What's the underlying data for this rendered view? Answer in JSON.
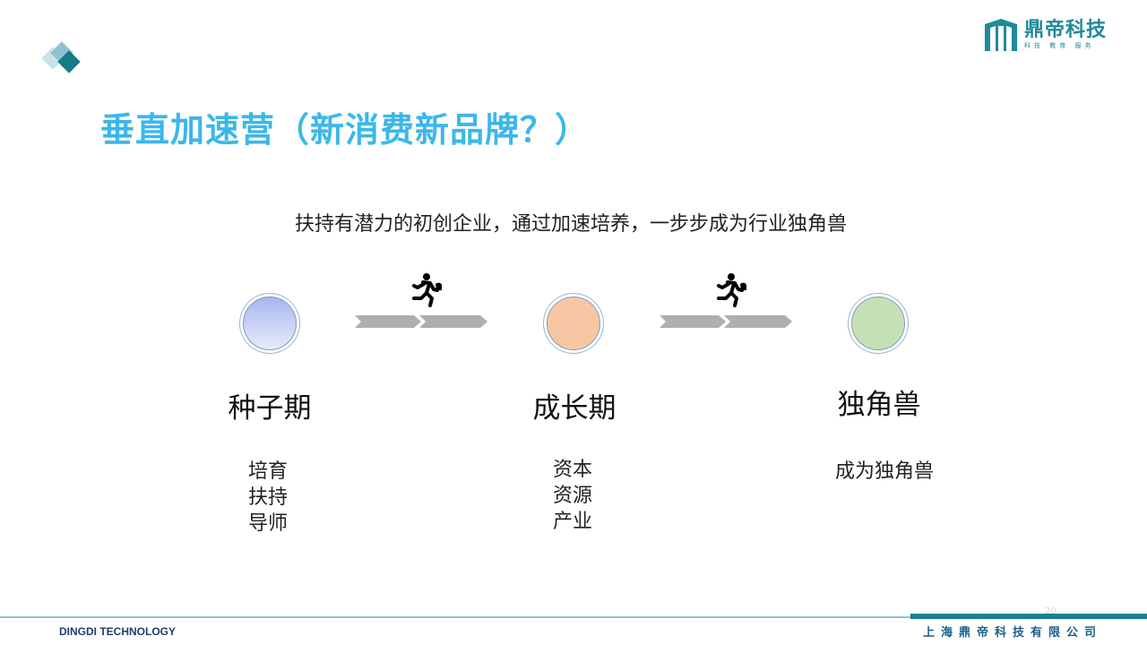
{
  "slide": {
    "title": "垂直加速营（新消费新品牌？）",
    "subtitle": "扶持有潜力的初创企业，通过加速培养，一步步成为行业独角兽",
    "page_number": "20"
  },
  "logo": {
    "name": "鼎帝科技",
    "tagline": "科技 教育 服务"
  },
  "stages": [
    {
      "label": "种子期",
      "details": [
        "培育",
        "扶持",
        "导师"
      ],
      "circle_color": "#b3c0f0"
    },
    {
      "label": "成长期",
      "details": [
        "资本",
        "资源",
        "产业"
      ],
      "circle_color": "#f7c7a4"
    },
    {
      "label": "独角兽",
      "details": [
        "成为独角兽"
      ],
      "circle_color": "#c6e0b5"
    }
  ],
  "icons": {
    "progress": "running-person-icon",
    "transition": "double-chevron-arrow-icon"
  },
  "footer": {
    "left_text": "DINGDI TECHNOLOGY",
    "right_text": "上海鼎帝科技有限公司"
  },
  "colors": {
    "title": "#3bb7ea",
    "brand": "#1b7f8e",
    "arrow": "#b0aeae"
  }
}
